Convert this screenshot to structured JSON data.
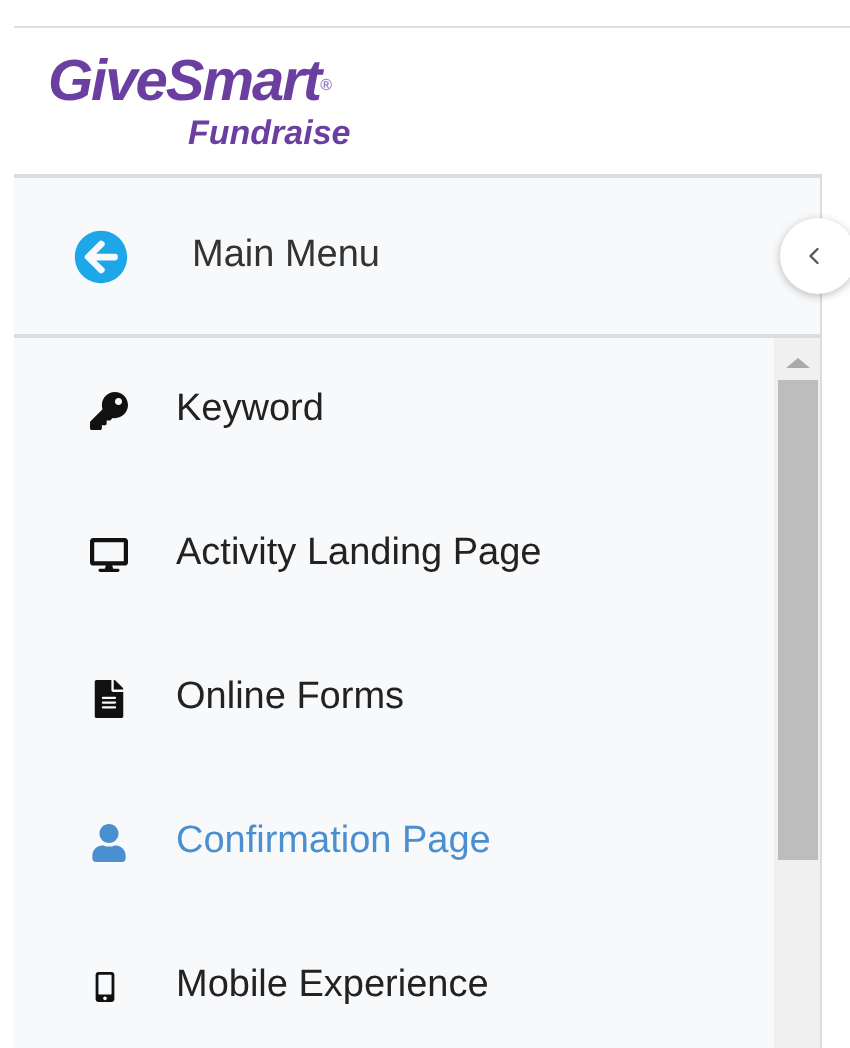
{
  "logo": {
    "name": "GiveSmart",
    "mark": "®",
    "product": "Fundraise"
  },
  "menu_header": {
    "label": "Main Menu"
  },
  "menu_items": [
    {
      "kind": "key",
      "label": "Keyword",
      "selected": false
    },
    {
      "kind": "desktop",
      "label": "Activity Landing Page",
      "selected": false
    },
    {
      "kind": "file",
      "label": "Online Forms",
      "selected": false
    },
    {
      "kind": "user",
      "label": "Confirmation Page",
      "selected": true
    },
    {
      "kind": "mobile",
      "label": "Mobile Experience",
      "selected": false
    }
  ]
}
